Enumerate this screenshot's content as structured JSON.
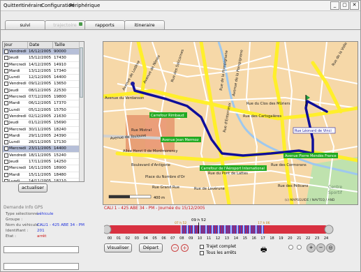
{
  "menu": [
    "Quitter",
    "Itinéraire",
    "Configuration",
    "Périphérique"
  ],
  "window_buttons": [
    "_",
    "▢",
    "✕"
  ],
  "tabs": [
    {
      "label": "suivi",
      "enabled": true
    },
    {
      "label": "trajectoire",
      "enabled": false
    },
    {
      "label": "rapports",
      "enabled": true
    },
    {
      "label": "itineraire",
      "enabled": true
    }
  ],
  "grid": {
    "columns": [
      "Jour",
      "Date",
      "Taille"
    ],
    "rows": [
      {
        "day": "Vendredi",
        "date": "16/12/2005",
        "size": "90000",
        "selected": true
      },
      {
        "day": "Jeudi",
        "date": "15/12/2005",
        "size": "17430",
        "selected": false
      },
      {
        "day": "Mercredi",
        "date": "14/12/2005",
        "size": "14910",
        "selected": false
      },
      {
        "day": "Mardi",
        "date": "13/12/2005",
        "size": "17340",
        "selected": false
      },
      {
        "day": "Lundi",
        "date": "12/12/2005",
        "size": "14400",
        "selected": false
      },
      {
        "day": "Vendredi",
        "date": "09/12/2005",
        "size": "13650",
        "selected": false
      },
      {
        "day": "Jeudi",
        "date": "08/12/2005",
        "size": "22530",
        "selected": false
      },
      {
        "day": "Mercredi",
        "date": "07/12/2005",
        "size": "19800",
        "selected": false
      },
      {
        "day": "Mardi",
        "date": "06/12/2005",
        "size": "17370",
        "selected": false
      },
      {
        "day": "Lundi",
        "date": "05/12/2005",
        "size": "15750",
        "selected": false
      },
      {
        "day": "Vendredi",
        "date": "02/12/2005",
        "size": "21630",
        "selected": false
      },
      {
        "day": "Jeudi",
        "date": "01/12/2005",
        "size": "15690",
        "selected": false
      },
      {
        "day": "Mercredi",
        "date": "30/11/2005",
        "size": "18240",
        "selected": false
      },
      {
        "day": "Mardi",
        "date": "29/11/2005",
        "size": "24390",
        "selected": false
      },
      {
        "day": "Lundi",
        "date": "28/11/2005",
        "size": "17130",
        "selected": false
      },
      {
        "day": "Mercredi",
        "date": "23/11/2005",
        "size": "14400",
        "selected": true
      },
      {
        "day": "Vendredi",
        "date": "18/11/2005",
        "size": "15240",
        "selected": false
      },
      {
        "day": "Jeudi",
        "date": "17/11/2005",
        "size": "14250",
        "selected": false
      },
      {
        "day": "Mercredi",
        "date": "16/11/2005",
        "size": "18900",
        "selected": false
      },
      {
        "day": "Mardi",
        "date": "15/11/2005",
        "size": "18480",
        "selected": false
      },
      {
        "day": "Lundi",
        "date": "14/11/2005",
        "size": "18210",
        "selected": false
      }
    ]
  },
  "refresh_button": "actualiser",
  "info": {
    "section_title": "Demande Info GPS",
    "type_label": "Type sélectionné :",
    "type_value": "véhicule",
    "group_label": "Groupe :",
    "group_value": "",
    "vehicle_label": "Nom du véhicule :",
    "vehicle_value": "CALI1 - 425 ABE 34 - PM",
    "id_label": "Identifiant :",
    "id_value": "201",
    "state_label": "Etat :",
    "state_value": "arrêt"
  },
  "caption": "CALI 1 - 425 ABE 34 - PM - Journée du 15/12/2005",
  "timeline": {
    "current_time": "09 h 52",
    "left_marker": "07 h 52",
    "right_marker": "17 h 06",
    "hours": [
      "00",
      "01",
      "02",
      "03",
      "04",
      "05",
      "06",
      "07",
      "08",
      "09",
      "10",
      "11",
      "12",
      "13",
      "14",
      "15",
      "16",
      "17",
      "18",
      "19",
      "20",
      "21",
      "22",
      "23",
      "24"
    ]
  },
  "controls": {
    "view_button": "Visualiser",
    "start_button": "Départ",
    "full_path_label": "Trajet complet",
    "all_stops_label": "Tous les arrêts"
  },
  "map": {
    "copyright": "(c) MAPSGUIDE / NAVTEQ / AND",
    "scale_label": "400 m",
    "area_label_line1": "Centre",
    "area_label_line2": "Sportif",
    "streets": [
      "Avenue de Nîmes",
      "Rue de la Pompignane",
      "Avenue de la Pompignane",
      "Rue des Salicornes",
      "Avenue de Lodève",
      "Avenue du Verdanson",
      "Rue du Clos des Mûriers",
      "Rue des Cartsgalères",
      "Rue de la Volle Fost",
      "Allée Henri II de Montmorency",
      "Boulevard d'Antigone",
      "Place du Nombre d'Or",
      "Rue des Cormorans",
      "Rue du Pont de Lattes",
      "Rue des Pélicans",
      "Rue de Lavérune",
      "Avenue de Toulouse",
      "Rue d'Enterrieux",
      "Rue Delcas",
      "Rue Mistral",
      "Rue Grand Rue"
    ],
    "poi": [
      "Carrefour Rimbaud",
      "Avenue Jean Mermoz",
      "Carrefour de l'Aéroport International",
      "Avenue Pierre Mendès France",
      "Rue Léonard de Vinci"
    ]
  },
  "colors": {
    "selection": "#b6bfd8",
    "map_bg": "#f6d8a8",
    "road_yellow": "#ffef2a",
    "route_blue": "#0e0e9a",
    "poi_bg": "#22aa22",
    "timeline_red": "#d83040",
    "timeline_blue": "#3a46d8"
  }
}
